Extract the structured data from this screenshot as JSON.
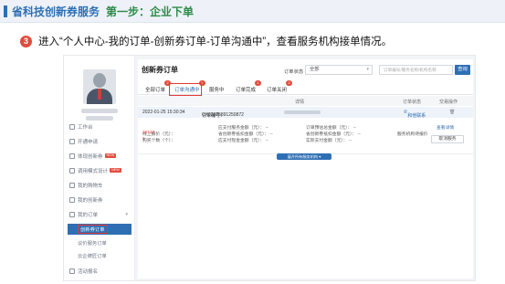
{
  "slide": {
    "title": "省科技创新券服务",
    "step_title": "第一步：企业下单",
    "step_number": "③",
    "instruction": "进入“个人中心-我的订单-创新券订单-订单沟通中”，查看服务机构接单情况。"
  },
  "sidebar": {
    "items": [
      {
        "label": "工作台",
        "icon": "desk-icon",
        "new": ""
      },
      {
        "label": "开通申请",
        "icon": "apply-icon",
        "new": ""
      },
      {
        "label": "体现创新券",
        "icon": "voucher-icon",
        "new": "NEW"
      },
      {
        "label": "调用模式设计",
        "icon": "mode-icon",
        "new": "NEW"
      },
      {
        "label": "我的购物车",
        "icon": "cart-icon",
        "new": ""
      },
      {
        "label": "我的创新券",
        "icon": "ticket-icon",
        "new": ""
      },
      {
        "label": "我的订单",
        "icon": "order-icon",
        "new": ""
      }
    ],
    "subitems": [
      {
        "label": "创新券订单",
        "active": true
      },
      {
        "label": "议价服务订单",
        "active": false
      },
      {
        "label": "云企牌匠订单",
        "active": false
      }
    ],
    "bottom_item": {
      "label": "活动报名",
      "icon": "event-icon"
    }
  },
  "main": {
    "title": "创新券订单",
    "filter_label": "订单状态",
    "filter_value": "全部",
    "search_placeholder": "订单编号/服务名称/机构名称",
    "search_button": "查询",
    "tabs": [
      {
        "label": "全部订单",
        "badge": "2"
      },
      {
        "label": "订单沟通中",
        "badge": "1"
      },
      {
        "label": "服务中",
        "badge": ""
      },
      {
        "label": "订单完成",
        "badge": "1"
      },
      {
        "label": "订单关闭",
        "badge": "2"
      }
    ],
    "table_headers": [
      "详情",
      "订单状态",
      "交易操作"
    ],
    "order": {
      "datetime": "2022-01-25 15:30:34",
      "order_no_label": "订单编号：",
      "order_no": "CX02025891250872",
      "contact": "和他联系",
      "quoted_price_label": "线上报价（元）：",
      "quoted_price": "22123",
      "quantity_label": "购买个数（个）：",
      "quantity": "1",
      "amounts_left": [
        "应支付服务金额（元）：  --",
        "省创新券抵扣金额（元）：  --",
        "应支付现金金额（元）：  --"
      ],
      "amounts_right": [
        "订单预估总金额（元）：  --",
        "省创新券抵扣金额（元）：  --",
        "实际支付金额（元）：  --"
      ],
      "status": "服务机构待报价",
      "detail_link": "查看详情",
      "cancel_button": "取消服务"
    },
    "expand_button": "展开所有服务机构 ▾"
  }
}
